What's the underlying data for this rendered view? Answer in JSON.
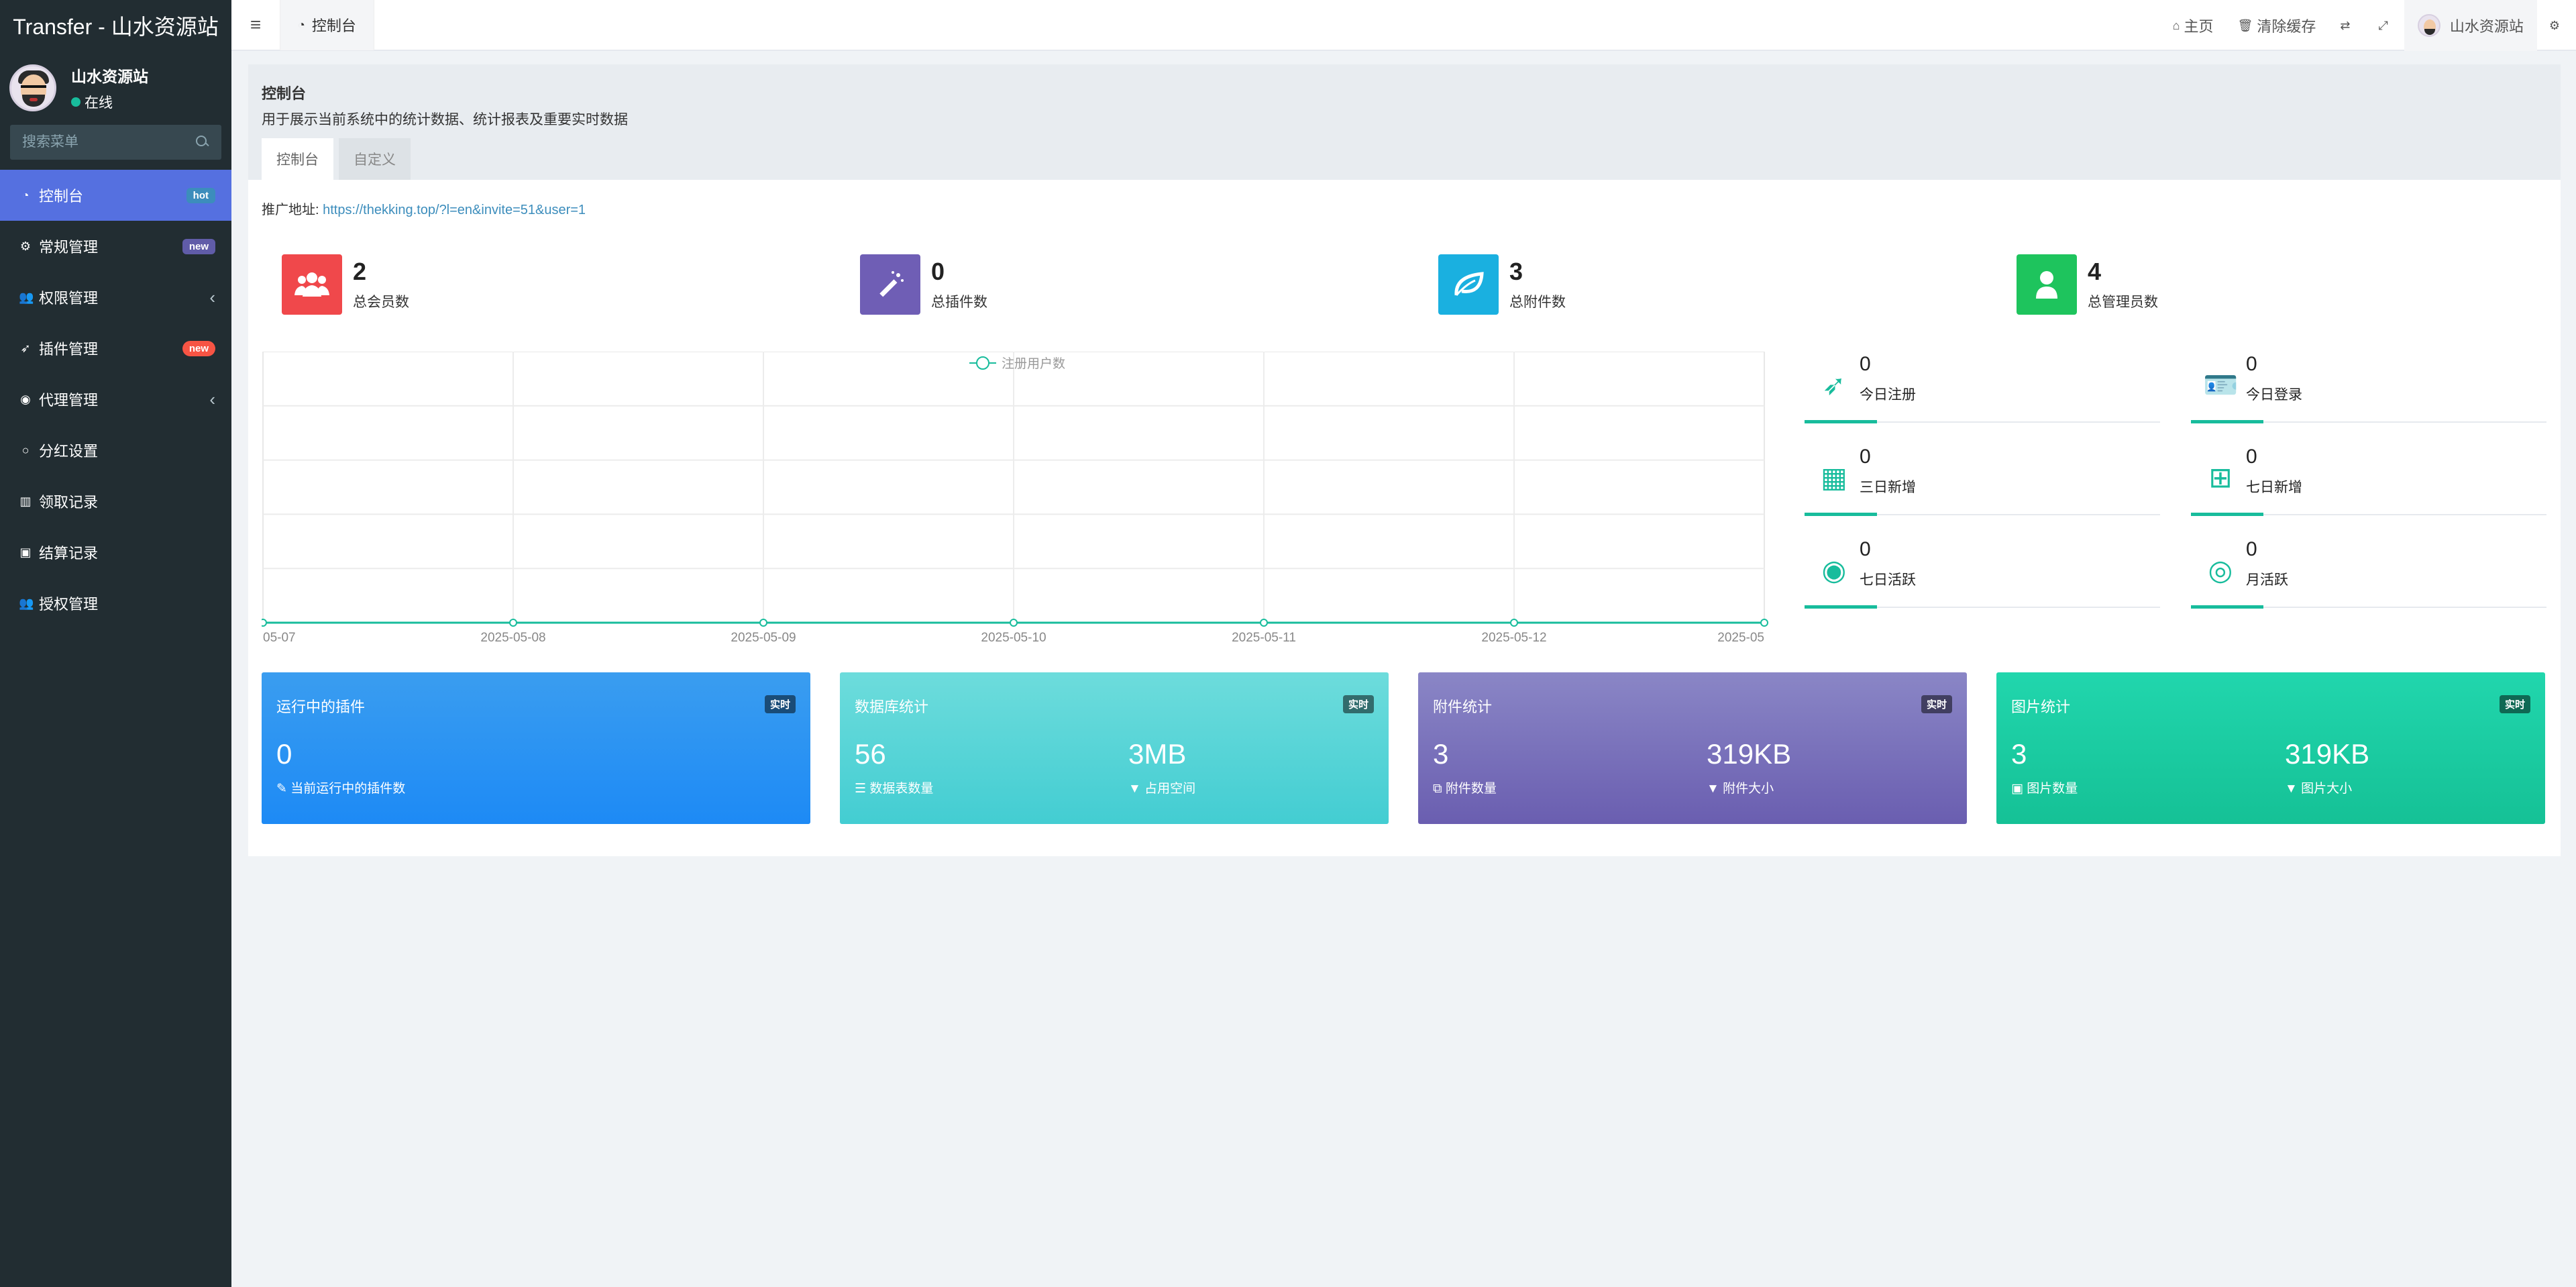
{
  "app": {
    "title": "Transfer - 山水资源站"
  },
  "user": {
    "name": "山水资源站",
    "status": "在线"
  },
  "search": {
    "placeholder": "搜索菜单"
  },
  "sidebar": {
    "items": [
      {
        "label": "控制台",
        "icon": "dashboard-icon",
        "badge": "hot"
      },
      {
        "label": "常规管理",
        "icon": "cogs-icon",
        "badge": "new"
      },
      {
        "label": "权限管理",
        "icon": "group-icon",
        "chevron": "‹"
      },
      {
        "label": "插件管理",
        "icon": "rocket-icon",
        "badge": "new"
      },
      {
        "label": "代理管理",
        "icon": "user-circle-icon",
        "chevron": "‹"
      },
      {
        "label": "分红设置",
        "icon": "circle-icon"
      },
      {
        "label": "领取记录",
        "icon": "list-icon"
      },
      {
        "label": "结算记录",
        "icon": "image-icon"
      },
      {
        "label": "授权管理",
        "icon": "group-icon"
      }
    ]
  },
  "header": {
    "tab": "控制台",
    "home": "主页",
    "clear_cache": "清除缓存",
    "user_name": "山水资源站"
  },
  "panel": {
    "title": "控制台",
    "desc": "用于展示当前系统中的统计数据、统计报表及重要实时数据",
    "tabs": [
      "控制台",
      "自定义"
    ],
    "promo_label": "推广地址:",
    "promo_url": "https://thekking.top/?l=en&invite=51&user=1"
  },
  "stats": [
    {
      "num": "2",
      "label": "总会员数",
      "color": "#f0484b",
      "icon": "users-icon"
    },
    {
      "num": "0",
      "label": "总插件数",
      "color": "#6f5eb5",
      "icon": "magic-icon"
    },
    {
      "num": "3",
      "label": "总附件数",
      "color": "#1ab0e0",
      "icon": "leaf-icon"
    },
    {
      "num": "4",
      "label": "总管理员数",
      "color": "#1ec45d",
      "icon": "user-icon"
    }
  ],
  "mini_stats": [
    {
      "num": "0",
      "label": "今日注册",
      "icon": "rocket-icon"
    },
    {
      "num": "0",
      "label": "今日登录",
      "icon": "id-card-icon"
    },
    {
      "num": "0",
      "label": "三日新增",
      "icon": "calendar-icon"
    },
    {
      "num": "0",
      "label": "七日新增",
      "icon": "calendar-plus-icon"
    },
    {
      "num": "0",
      "label": "七日活跃",
      "icon": "user-circle-icon"
    },
    {
      "num": "0",
      "label": "月活跃",
      "icon": "user-circle-o-icon"
    }
  ],
  "cards": [
    {
      "title": "运行中的插件",
      "tag": "实时",
      "color": "blue",
      "v1": "0",
      "l1": "当前运行中的插件数"
    },
    {
      "title": "数据库统计",
      "tag": "实时",
      "color": "cyan",
      "v1": "56",
      "l1": "数据表数量",
      "v2": "3MB",
      "l2": "占用空间"
    },
    {
      "title": "附件统计",
      "tag": "实时",
      "color": "purple",
      "v1": "3",
      "l1": "附件数量",
      "v2": "319KB",
      "l2": "附件大小"
    },
    {
      "title": "图片统计",
      "tag": "实时",
      "color": "green",
      "v1": "3",
      "l1": "图片数量",
      "v2": "319KB",
      "l2": "图片大小"
    }
  ],
  "chart_data": {
    "type": "line",
    "x": [
      "05-07",
      "2025-05-08",
      "2025-05-09",
      "2025-05-10",
      "2025-05-11",
      "2025-05-12",
      "2025-05"
    ],
    "series": [
      {
        "name": "注册用户数",
        "values": [
          0,
          0,
          0,
          0,
          0,
          0,
          0
        ]
      }
    ],
    "color": "#18bc9c",
    "grid": true,
    "legend": "top-center"
  }
}
